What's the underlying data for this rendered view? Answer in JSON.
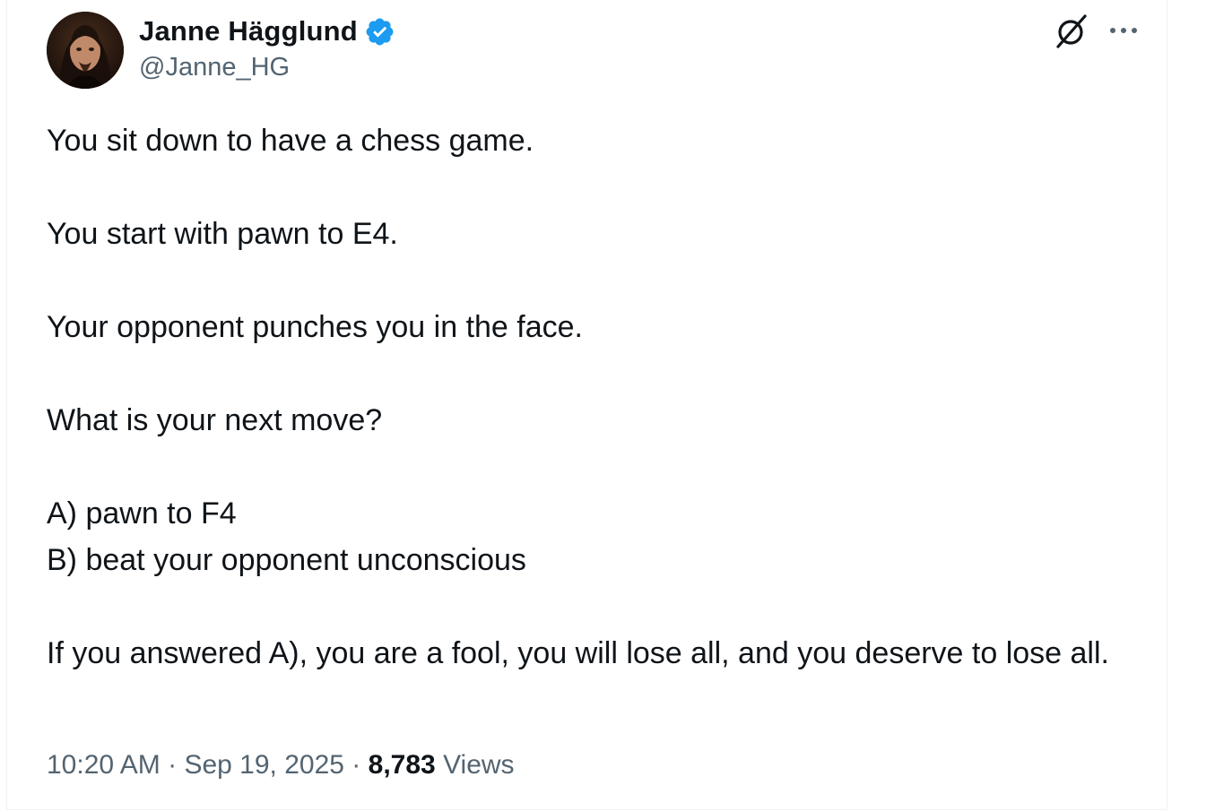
{
  "author": {
    "display_name": "Janne Hägglund",
    "handle": "@Janne_HG",
    "verified": true
  },
  "tweet": {
    "lines": [
      "You sit down to have a chess game.",
      "You start with pawn to E4.",
      "Your opponent punches you in the face.",
      "What is your next move?",
      "A) pawn to F4",
      "B) beat your opponent unconscious",
      "If you answered A), you are a fool, you will lose all, and you deserve to lose all."
    ]
  },
  "meta": {
    "time": "10:20 AM",
    "separator": "·",
    "date": "Sep 19, 2025",
    "views_count": "8,783",
    "views_label": "Views"
  },
  "icons": {
    "verified": "verified-badge-icon",
    "grok": "grok-icon",
    "more": "more-options-icon"
  },
  "colors": {
    "text": "#0f1419",
    "secondary": "#536471",
    "verified_blue": "#1d9bf0",
    "border": "#eff3f4"
  }
}
